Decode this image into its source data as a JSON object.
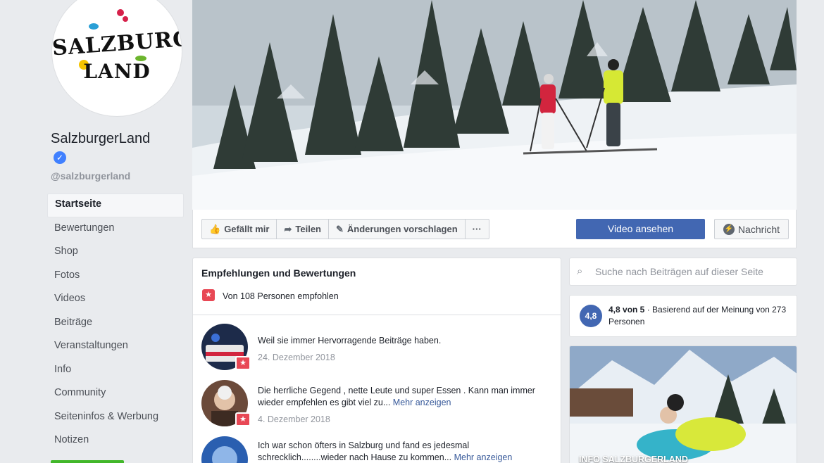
{
  "page": {
    "name": "SalzburgerLand",
    "handle": "@salzburgerland",
    "logo_line1": "SALZBURGER",
    "logo_line2": "LAND"
  },
  "nav": {
    "items": [
      {
        "label": "Startseite",
        "active": true
      },
      {
        "label": "Bewertungen"
      },
      {
        "label": "Shop"
      },
      {
        "label": "Fotos"
      },
      {
        "label": "Videos"
      },
      {
        "label": "Beiträge"
      },
      {
        "label": "Veranstaltungen"
      },
      {
        "label": "Info"
      },
      {
        "label": "Community"
      },
      {
        "label": "Seiteninfos & Werbung"
      },
      {
        "label": "Notizen"
      }
    ]
  },
  "actions": {
    "like": "Gefällt mir",
    "share": "Teilen",
    "suggest": "Änderungen vorschlagen",
    "more": "···",
    "video": "Video ansehen",
    "message": "Nachricht"
  },
  "reviews": {
    "title": "Empfehlungen und Bewertungen",
    "recommended": "Von 108 Personen empfohlen",
    "items": [
      {
        "text": "Weil sie immer Hervorragende Beiträge haben.",
        "more": "",
        "date": "24. Dezember 2018"
      },
      {
        "text": "Die herrliche Gegend , nette Leute und super Essen . Kann man immer wieder empfehlen es gibt viel zu...",
        "more": "Mehr anzeigen",
        "date": "4. Dezember 2018"
      },
      {
        "text": "Ich war schon öfters in Salzburg und fand es jedesmal schrecklich........wieder nach Hause zu kommen...",
        "more": "Mehr anzeigen",
        "date": ""
      }
    ]
  },
  "search": {
    "placeholder": "Suche nach Beiträgen auf dieser Seite"
  },
  "rating": {
    "score": "4,8",
    "headline": "4,8 von 5",
    "detail": " · Basierend auf der Meinung von 273 Personen"
  },
  "info_card": {
    "label": "INFO SALZBURGERLAND"
  },
  "colors": {
    "brand_blue": "#4267b2",
    "verified_blue": "#4080ff",
    "recommend_red": "#e84855",
    "link": "#365899"
  }
}
